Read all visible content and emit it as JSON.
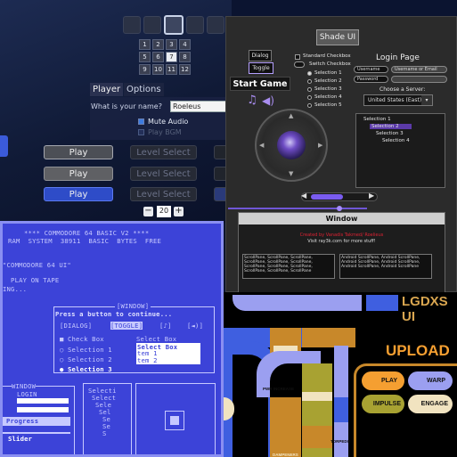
{
  "dark_ui": {
    "numpad": [
      "1",
      "2",
      "3",
      "4",
      "5",
      "6",
      "7",
      "8",
      "9",
      "10",
      "11",
      "12"
    ],
    "numpad_selected": "7",
    "tabs": [
      "Player",
      "Options"
    ],
    "name_prompt": "What is your name?",
    "name_value": "Roeleus",
    "mute_audio": "Mute Audio",
    "play_bgm": "Play BGM",
    "play_buttons": [
      "Play",
      "Play",
      "Play"
    ],
    "level_select": [
      "Level Select",
      "Level Select",
      "Level Select"
    ],
    "stepper_value": "20",
    "stepper_minus": "−",
    "stepper_plus": "+"
  },
  "raygui": {
    "shade_button": "Shade UI",
    "dialog_button": "Dialog",
    "toggle_button": "Toggle",
    "standard_checkbox": "Standard Checkbox",
    "switch_checkbox": "Switch Checkbox",
    "selections": [
      "Selection 1",
      "Selection 2",
      "Selection 3",
      "Selection 4",
      "Selection 5"
    ],
    "login_title": "Login Page",
    "username": "Username",
    "password": "Password",
    "username_placeholder": "Username or Email",
    "password_placeholder": "",
    "server_label": "Choose a Server:",
    "server_value": "United States (East)",
    "start_game": "Start Game",
    "tree": [
      "Selection 1",
      "Selection 2",
      "Selection 3",
      "Selection 4"
    ],
    "window_title": "Window",
    "window_credit": "Created by Vanadis Takmed/ Roelieus",
    "window_link": "Visit ray3k.com for more stuff!",
    "scroll_left": "ScrollPane, ScrollPane, ScrollPane, ScrollPane, ScrollPane, ScrollPane, ScrollPane, ScrollPane, ScrollPane, ScrollPane, ScrollPane, ScrollPane",
    "scroll_right": "Android ScrollPane, Android ScrollPane, Android ScrollPane, Android ScrollPane, Android ScrollPane, Android ScrollPane"
  },
  "c64": {
    "header": "**** COMMODORE 64 BASIC V2 ****",
    "ram": "RAM  SYSTEM  38911  BASIC  BYTES  FREE",
    "line1": "\"COMMODORE 64 UI\"",
    "line2": "  PLAY ON TAPE",
    "line3": "ING...",
    "window_title": "[WINDOW]",
    "prompt": "Press a button to continue...",
    "buttons": [
      "[DIALOG]",
      "[TOGGLE]",
      "[♪]",
      "[◄)]"
    ],
    "checkbox": "Check Box",
    "selections": [
      "Selection 1",
      "Selection 2",
      "Selection 3"
    ],
    "select_box": "Select Box",
    "select_items": [
      "Select Box",
      "tem 1",
      "tem 2"
    ],
    "window2_title": "WINDOW",
    "login": "LOGIN",
    "progress": "Progress",
    "slider": "Slider",
    "tree": [
      "Selecti",
      "Select",
      "Sele",
      "Sel",
      "Se",
      "Se",
      "S"
    ]
  },
  "lcars": {
    "title": "LGDXS UI",
    "upload": "UPLOAD",
    "buttons": [
      "PLAY",
      "WARP",
      "IMPULSE",
      "ENGAGE"
    ],
    "labels": [
      "PWR INCREASE",
      "TORPEDO",
      "DAMPENERS"
    ],
    "colors": {
      "orange": "#f59f31",
      "lavender": "#9b9ff0",
      "olive": "#a8a232",
      "cream": "#f1e3c0",
      "blue": "#3f5fe0",
      "amber": "#c8882a"
    }
  }
}
